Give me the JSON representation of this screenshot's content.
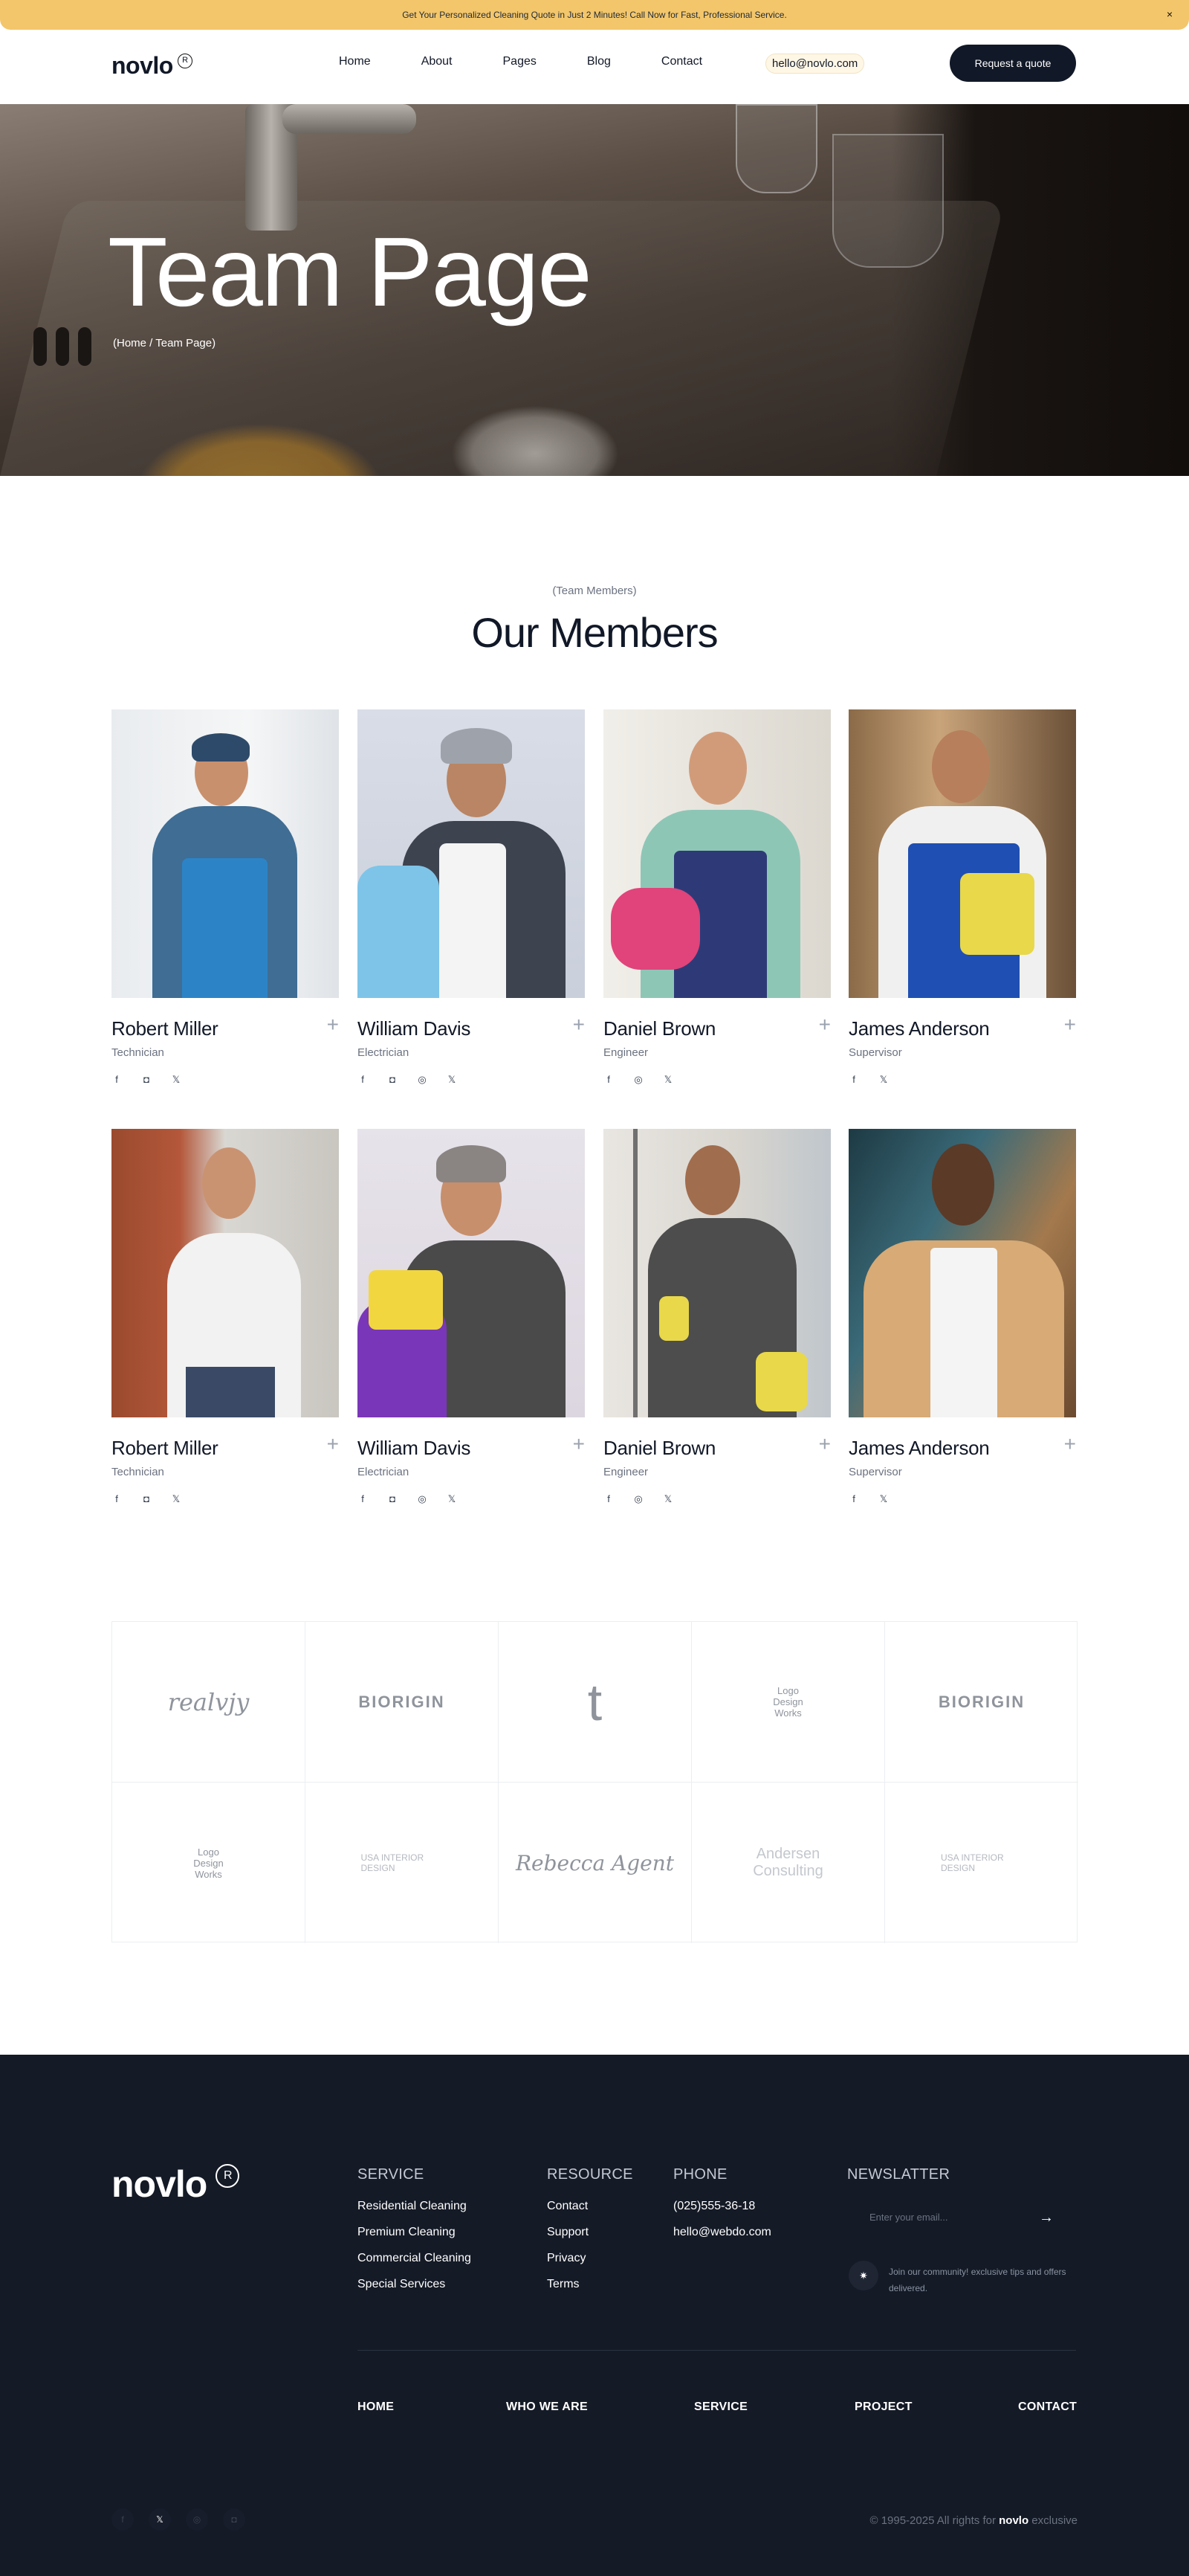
{
  "topbar": {
    "message": "Get Your Personalized Cleaning Quote in Just 2 Minutes! Call Now for Fast, Professional Service.",
    "close_icon": "×"
  },
  "header": {
    "logo": "novlo",
    "logo_mark": "R",
    "nav": [
      "Home",
      "About",
      "Pages",
      "Blog",
      "Contact"
    ],
    "email": "hello@novlo.com",
    "cta": "Request a quote"
  },
  "hero": {
    "title": "Team Page",
    "breadcrumb": "(Home / Team Page)"
  },
  "members_section": {
    "eyebrow": "(Team Members)",
    "title": "Our Members",
    "plus_icon": "+",
    "members": [
      {
        "name": "Robert Miller",
        "role": "Technician",
        "socials": [
          "facebook-icon",
          "instagram-icon",
          "x-icon"
        ]
      },
      {
        "name": "William Davis",
        "role": "Electrician",
        "socials": [
          "facebook-icon",
          "instagram-icon",
          "dribbble-icon",
          "x-icon"
        ]
      },
      {
        "name": "Daniel Brown",
        "role": "Engineer",
        "socials": [
          "facebook-icon",
          "dribbble-icon",
          "x-icon"
        ]
      },
      {
        "name": "James Anderson",
        "role": "Supervisor",
        "socials": [
          "facebook-icon",
          "x-icon"
        ]
      },
      {
        "name": "Robert Miller",
        "role": "Technician",
        "socials": [
          "facebook-icon",
          "instagram-icon",
          "x-icon"
        ]
      },
      {
        "name": "William Davis",
        "role": "Electrician",
        "socials": [
          "facebook-icon",
          "instagram-icon",
          "dribbble-icon",
          "x-icon"
        ]
      },
      {
        "name": "Daniel Brown",
        "role": "Engineer",
        "socials": [
          "facebook-icon",
          "dribbble-icon",
          "x-icon"
        ]
      },
      {
        "name": "James Anderson",
        "role": "Supervisor",
        "socials": [
          "facebook-icon",
          "x-icon"
        ]
      }
    ]
  },
  "partner_logos": [
    "realvjy",
    "BIORIGIN",
    "t",
    "Logo Design Works",
    "BIORIGIN",
    "Logo Design Works",
    "USA INTERIOR DESIGN",
    "Rebecca Agent",
    "Andersen Consulting",
    "USA INTERIOR DESIGN"
  ],
  "footer": {
    "logo": "novlo",
    "logo_mark": "R",
    "service": {
      "title": "SERVICE",
      "items": [
        "Residential Cleaning",
        "Premium Cleaning",
        "Commercial Cleaning",
        "Special Services"
      ]
    },
    "resource": {
      "title": "RESOURCE",
      "items": [
        "Contact",
        "Support",
        "Privacy",
        "Terms"
      ]
    },
    "phone": {
      "title": "PHONE",
      "items": [
        "(025)555-36-18",
        "hello@webdo.com"
      ]
    },
    "newsletter": {
      "title": "NEWSLATTER",
      "placeholder": "Enter your email...",
      "arrow": "→",
      "note": "Join our community! exclusive tips and offers delivered."
    },
    "bottom_nav": [
      "HOME",
      "WHO WE ARE",
      "SERVICE",
      "PROJECT",
      "CONTACT"
    ],
    "copyright_prefix": "© 1995-2025 All rights for",
    "copyright_brand": "novlo",
    "copyright_suffix": "exclusive"
  },
  "colors": {
    "topbar": "#f3c66b",
    "dark": "#111827",
    "footer_bg": "#141a26",
    "muted": "#6b7280"
  }
}
